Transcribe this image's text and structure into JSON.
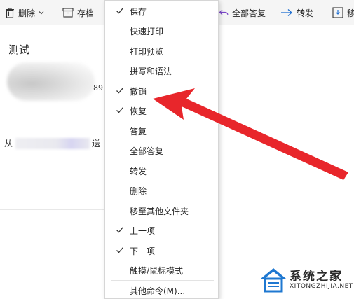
{
  "toolbar": {
    "delete_label": "删除",
    "archive_label": "存档",
    "reply_all_label": "全部答复",
    "forward_label": "转发",
    "move_label": "移"
  },
  "reading_pane": {
    "subject": "测试",
    "number_fragment": "89",
    "from_label": "从",
    "from_suffix": "送"
  },
  "context_menu": {
    "items": [
      {
        "label": "保存",
        "checked": true
      },
      {
        "label": "快速打印",
        "checked": false
      },
      {
        "label": "打印预览",
        "checked": false
      },
      {
        "label": "拼写和语法",
        "checked": false
      },
      {
        "label": "撤销",
        "checked": true
      },
      {
        "label": "恢复",
        "checked": true
      },
      {
        "label": "答复",
        "checked": false
      },
      {
        "label": "全部答复",
        "checked": false
      },
      {
        "label": "转发",
        "checked": false
      },
      {
        "label": "删除",
        "checked": false
      },
      {
        "label": "移至其他文件夹",
        "checked": false
      },
      {
        "label": "上一项",
        "checked": true
      },
      {
        "label": "下一项",
        "checked": true
      },
      {
        "label": "触摸/鼠标模式",
        "checked": false
      },
      {
        "label": "其他命令(M)...",
        "checked": false
      }
    ]
  },
  "annotation": {
    "color": "#e8262b"
  },
  "watermark": {
    "title": "系统之家",
    "url": "XITONGZHIJIA.NET"
  },
  "colors": {
    "toolbar_bg": "#f5f5f5",
    "menu_border": "#d6d6d6",
    "accent_blue": "#0f6cbd"
  }
}
